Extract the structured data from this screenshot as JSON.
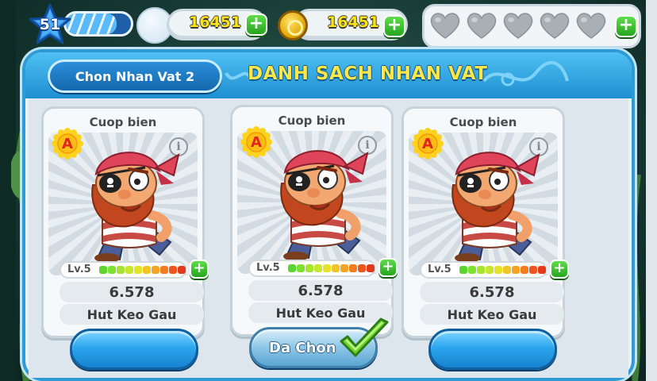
{
  "top_bar": {
    "level": "51",
    "xp_fraction": 0.78,
    "gems": "16451",
    "coins": "16451",
    "hearts_total": 5,
    "hearts_filled": 0,
    "gems_plus_icon": "plus-icon",
    "coins_plus_icon": "plus-icon",
    "hearts_plus_icon": "plus-icon"
  },
  "panel": {
    "title": "DANH SACH NHAN VAT",
    "sub_button_label": "Chon Nhan Vat 2"
  },
  "cards": [
    {
      "name": "Cuop bien",
      "rank": "A",
      "level_label": "Lv.5",
      "level_fraction": 1.0,
      "stat": "6.578",
      "skill": "Hut Keo Gau",
      "button_label": "",
      "selected": false
    },
    {
      "name": "Cuop bien",
      "rank": "A",
      "level_label": "Lv.5",
      "level_fraction": 1.0,
      "stat": "6.578",
      "skill": "Hut Keo Gau",
      "button_label": "Da Chon",
      "selected": true
    },
    {
      "name": "Cuop bien",
      "rank": "A",
      "level_label": "Lv.5",
      "level_fraction": 1.0,
      "stat": "6.578",
      "skill": "Hut Keo Gau",
      "button_label": "",
      "selected": false
    }
  ],
  "colors": {
    "panel_border": "#2e9bd6",
    "title_yellow": "#ffe74a",
    "currency_yellow": "#ffe21a",
    "plus_green": "#26a51f"
  }
}
